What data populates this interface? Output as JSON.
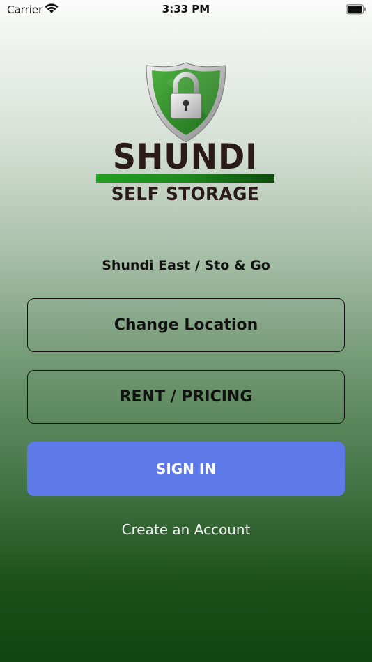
{
  "status_bar": {
    "carrier": "Carrier",
    "time": "3:33 PM",
    "wifi_icon": "wifi-icon",
    "battery_icon": "battery-icon"
  },
  "logo": {
    "title": "SHUNDI",
    "subtitle": "SELF STORAGE",
    "icon": "shield-lock-icon"
  },
  "location": {
    "name": "Shundi East / Sto & Go"
  },
  "buttons": {
    "change_location": "Change Location",
    "rent_pricing": "RENT / PRICING",
    "sign_in": "SIGN IN",
    "create_account": "Create an Account"
  },
  "colors": {
    "sign_in_bg": "#5d7ae8",
    "brand_green": "#1d8a1d",
    "brand_dark": "#2a1a1a"
  }
}
